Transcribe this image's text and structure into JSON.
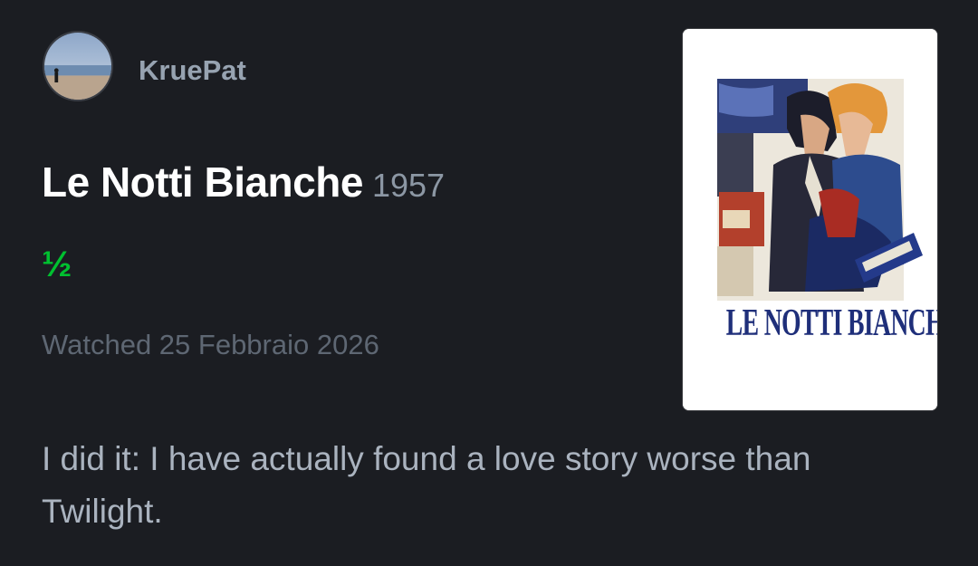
{
  "review": {
    "author": "KruePat",
    "film_title": "Le Notti Bianche",
    "film_year": "1957",
    "rating": "½",
    "watched_label": "Watched 25 Febbraio 2026",
    "body": "I did it: I have actually found a love story worse than Twilight."
  },
  "poster": {
    "title_text": "LE NOTTI BIANCHE"
  },
  "colors": {
    "background": "#1b1d22",
    "rating_green": "#00c030",
    "poster_title_blue": "#1f2f7a"
  },
  "icons": {
    "avatar": "avatar-photo"
  }
}
